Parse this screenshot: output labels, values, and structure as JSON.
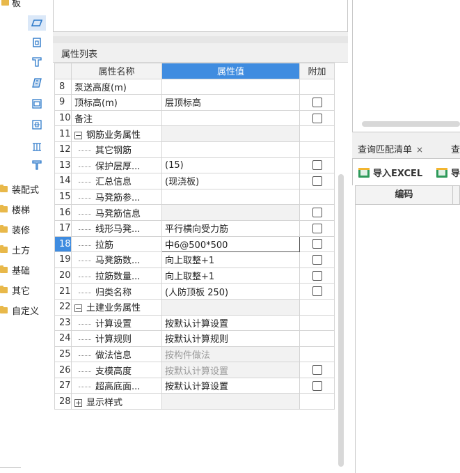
{
  "tree": {
    "top_label": "板",
    "categories": [
      "装配式",
      "楼梯",
      "装修",
      "土方",
      "基础",
      "其它",
      "自定义"
    ]
  },
  "icons": [
    "slab-icon",
    "slab-hole-icon",
    "slab-beam-icon",
    "slab-belt-icon",
    "slab-column-cap-icon",
    "slab-post-icon",
    "slab-joist-icon",
    "slab-funnel-icon"
  ],
  "property_panel": {
    "title": "属性列表",
    "columns": {
      "name": "属性名称",
      "value": "属性值",
      "extra": "附加"
    },
    "rows": [
      {
        "num": "8",
        "name": "泵送高度(m)",
        "value": "",
        "checkbox": false
      },
      {
        "num": "9",
        "name": "顶标高(m)",
        "value": "层顶标高",
        "checkbox": true
      },
      {
        "num": "10",
        "name": "备注",
        "value": "",
        "checkbox": true
      },
      {
        "num": "11",
        "name": "钢筋业务属性",
        "value": "",
        "checkbox": false
      },
      {
        "num": "12",
        "name": "其它钢筋",
        "value": "",
        "checkbox": false
      },
      {
        "num": "13",
        "name": "保护层厚...",
        "value": "(15)",
        "checkbox": true
      },
      {
        "num": "14",
        "name": "汇总信息",
        "value": "(现浇板)",
        "checkbox": true
      },
      {
        "num": "15",
        "name": "马凳筋参...",
        "value": "",
        "checkbox": false
      },
      {
        "num": "16",
        "name": "马凳筋信息",
        "value": "",
        "checkbox": true
      },
      {
        "num": "17",
        "name": "线形马凳...",
        "value": "平行横向受力筋",
        "checkbox": true
      },
      {
        "num": "18",
        "name": "拉筋",
        "value": "中6@500*500",
        "checkbox": true
      },
      {
        "num": "19",
        "name": "马凳筋数...",
        "value": "向上取整+1",
        "checkbox": true
      },
      {
        "num": "20",
        "name": "拉筋数量...",
        "value": "向上取整+1",
        "checkbox": true
      },
      {
        "num": "21",
        "name": "归类名称",
        "value": "(人防顶板 250)",
        "checkbox": true
      },
      {
        "num": "22",
        "name": "土建业务属性",
        "value": "",
        "checkbox": false
      },
      {
        "num": "23",
        "name": "计算设置",
        "value": "按默认计算设置",
        "checkbox": false
      },
      {
        "num": "24",
        "name": "计算规则",
        "value": "按默认计算规则",
        "checkbox": false
      },
      {
        "num": "25",
        "name": "做法信息",
        "value": "按构件做法",
        "checkbox": false
      },
      {
        "num": "26",
        "name": "支模高度",
        "value": "按默认计算设置",
        "checkbox": true
      },
      {
        "num": "27",
        "name": "超高底面...",
        "value": "按默认计算设置",
        "checkbox": true
      },
      {
        "num": "28",
        "name": "显示样式",
        "value": "",
        "checkbox": false
      }
    ]
  },
  "right_panel": {
    "tab_active": "查询匹配清单",
    "tab_close": "×",
    "tab_next": "查",
    "btn_import": "导入EXCEL",
    "btn_next": "导",
    "col_code": "编码"
  },
  "colors": {
    "accent": "#3f8ce0",
    "link_blue": "#2b6fd6",
    "folder": "#e8b84a"
  }
}
